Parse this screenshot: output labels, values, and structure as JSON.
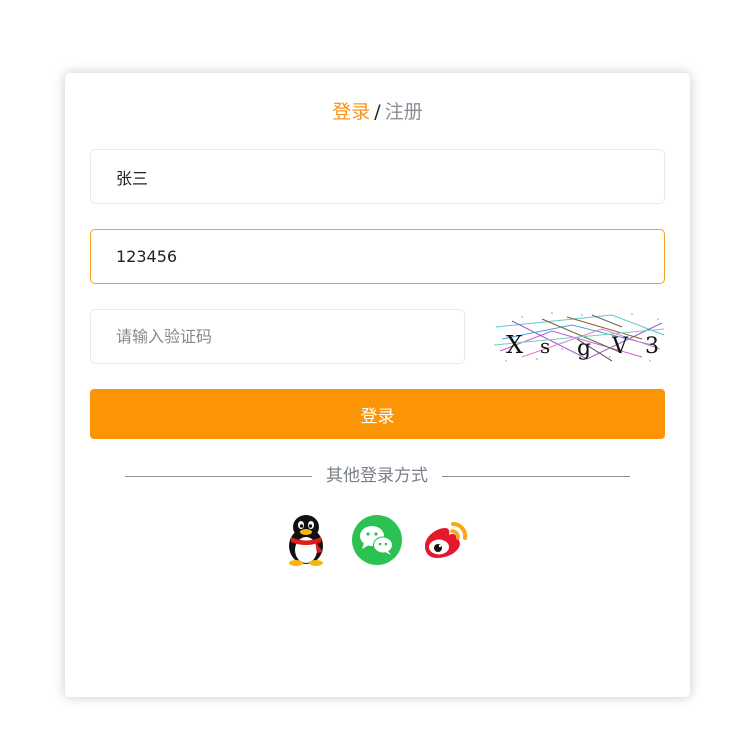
{
  "tabs": {
    "login": "登录",
    "separator": "/",
    "register": "注册"
  },
  "form": {
    "username_value": "张三",
    "password_value": "123456",
    "captcha_placeholder": "请输入验证码",
    "captcha_text": "XsgV3",
    "submit_label": "登录"
  },
  "other_login": {
    "label": "其他登录方式",
    "icons": [
      "qq-icon",
      "wechat-icon",
      "weibo-icon"
    ]
  },
  "colors": {
    "accent": "#f7921c",
    "button": "#fb9505",
    "wechat": "#2aae67",
    "weibo": "#e6162d"
  }
}
